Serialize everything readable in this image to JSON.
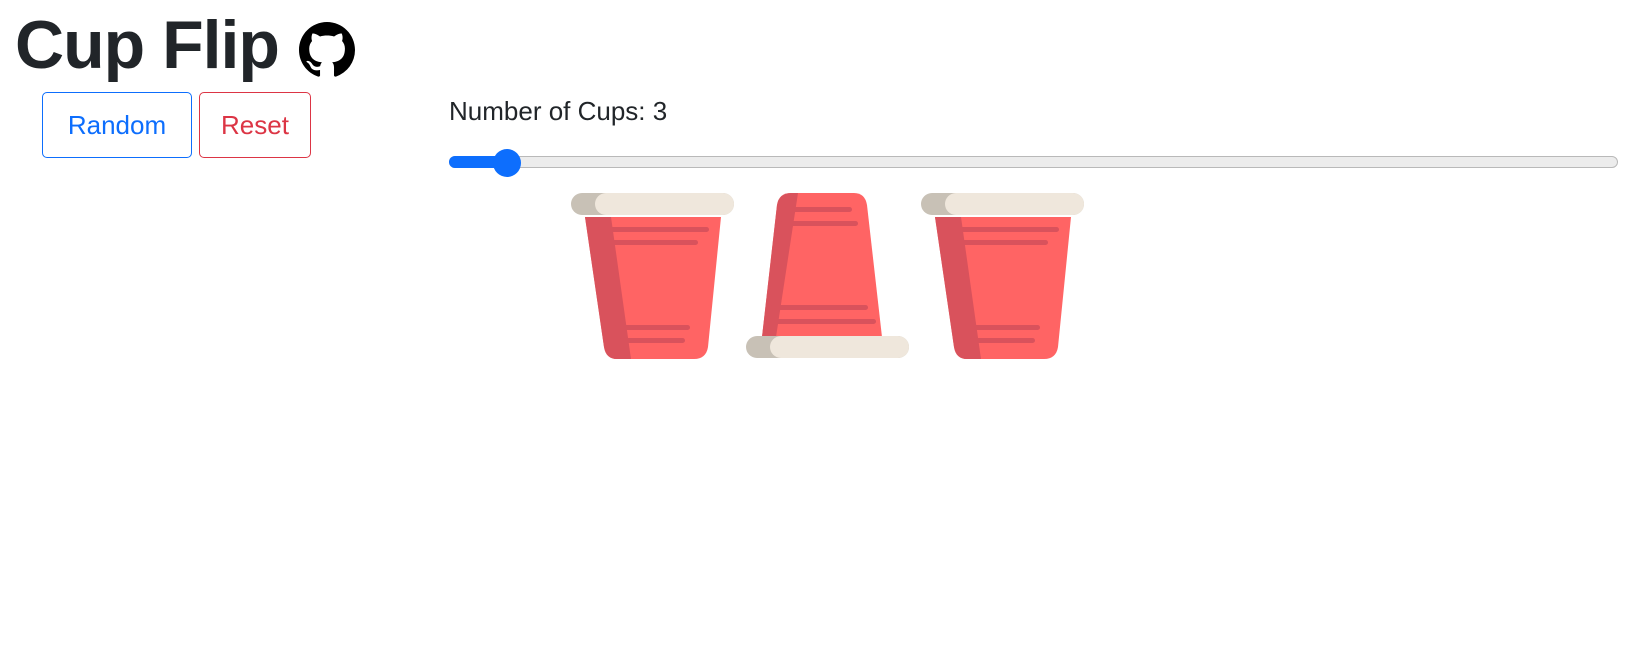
{
  "header": {
    "title": "Cup Flip",
    "github_icon": "github-icon"
  },
  "controls": {
    "random_label": "Random",
    "reset_label": "Reset"
  },
  "slider": {
    "label": "Number of Cups: 3",
    "min": 3,
    "max": 60,
    "value": 3,
    "fill_fraction": 0.05
  },
  "cups": [
    {
      "state": "upright",
      "icon": "cup-icon"
    },
    {
      "state": "flipped",
      "icon": "cup-icon"
    },
    {
      "state": "upright",
      "icon": "cup-icon"
    }
  ],
  "colors": {
    "primary": "#0d6efd",
    "danger": "#dc3545",
    "cup_red": "#ff6464",
    "cup_shadow": "#d9525c",
    "rim": "#efe7dc",
    "rim_shadow": "#c8c1b6"
  }
}
